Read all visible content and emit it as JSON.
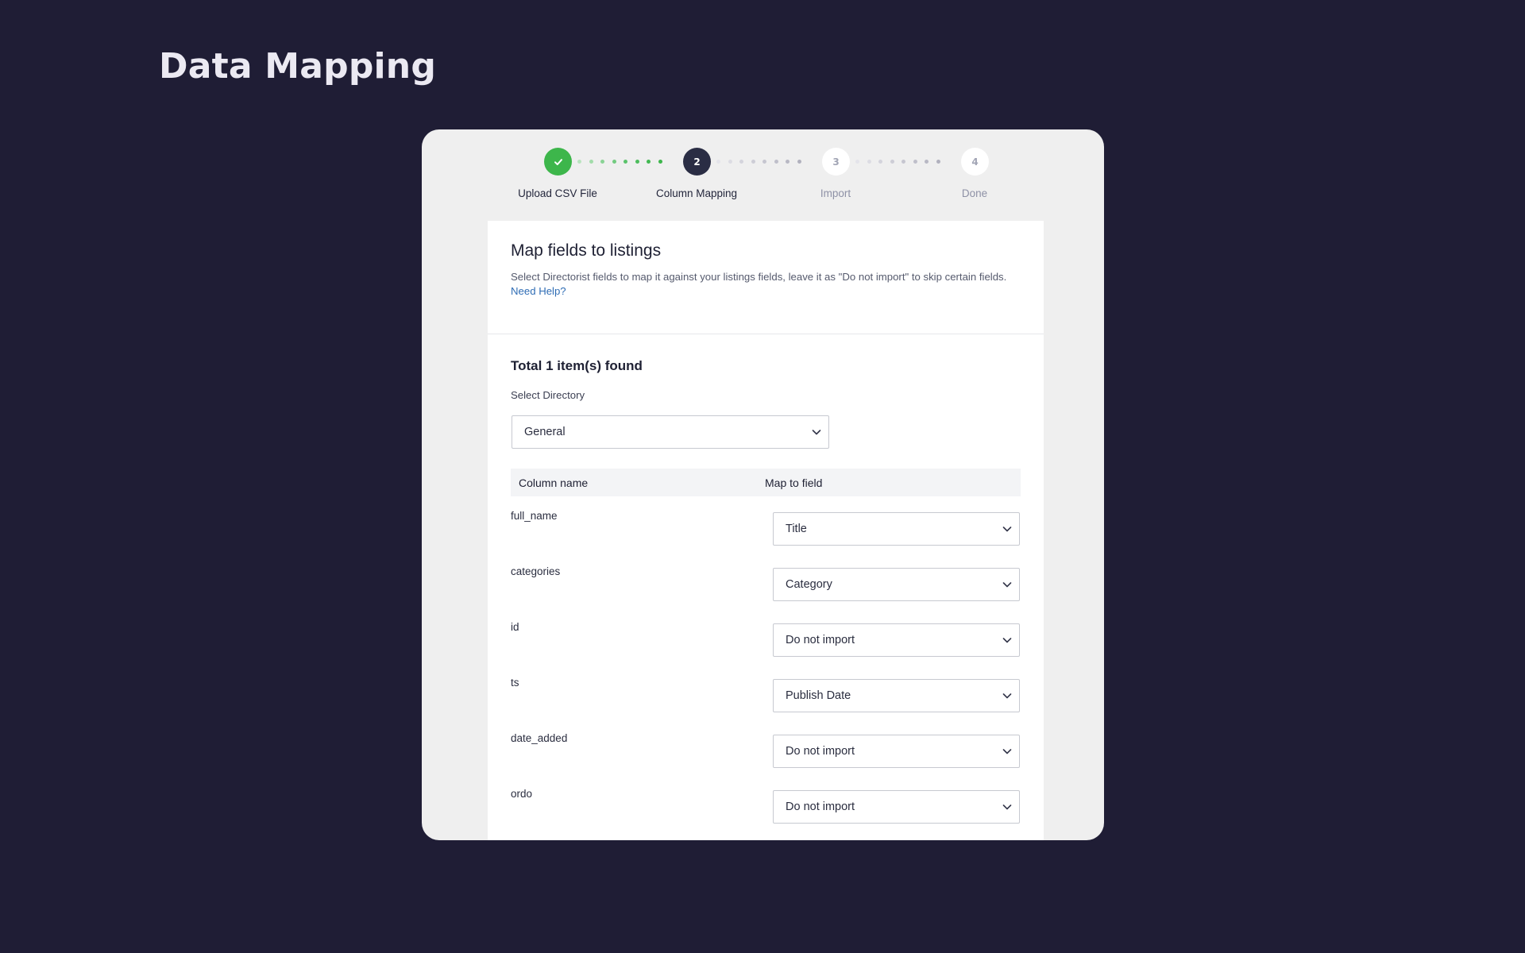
{
  "page": {
    "title": "Data Mapping"
  },
  "stepper": {
    "steps": [
      {
        "number": "✓",
        "label": "Upload CSV File",
        "state": "done"
      },
      {
        "number": "2",
        "label": "Column Mapping",
        "state": "current"
      },
      {
        "number": "3",
        "label": "Import",
        "state": "todo"
      },
      {
        "number": "4",
        "label": "Done",
        "state": "todo"
      }
    ]
  },
  "panel": {
    "title": "Map fields to listings",
    "description": "Select Directorist fields to map it against your listings fields, leave it as \"Do not import\" to skip certain fields.",
    "help_link": "Need Help?"
  },
  "summary": {
    "found": "Total 1 item(s) found",
    "directory_label": "Select Directory",
    "directory_value": "General"
  },
  "table": {
    "headers": {
      "column": "Column name",
      "map": "Map to field"
    },
    "rows": [
      {
        "column": "full_name",
        "field": "Title"
      },
      {
        "column": "categories",
        "field": "Category"
      },
      {
        "column": "id",
        "field": "Do not import"
      },
      {
        "column": "ts",
        "field": "Publish Date"
      },
      {
        "column": "date_added",
        "field": "Do not import"
      },
      {
        "column": "ordo",
        "field": "Do not import"
      }
    ]
  },
  "colors": {
    "background": "#1f1d35",
    "card": "#efefef",
    "step_done": "#3db64b",
    "step_current": "#2a2d44",
    "link": "#2f6db5"
  }
}
